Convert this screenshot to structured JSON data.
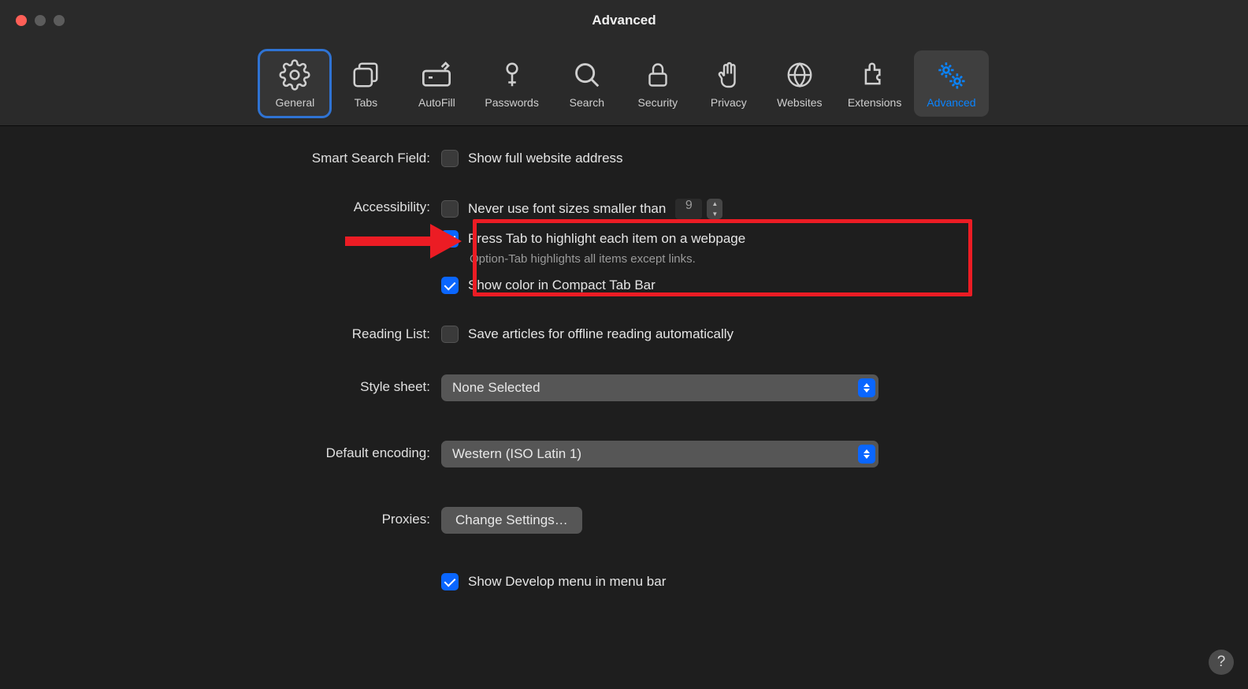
{
  "window": {
    "title": "Advanced"
  },
  "toolbar": {
    "items": [
      {
        "label": "General"
      },
      {
        "label": "Tabs"
      },
      {
        "label": "AutoFill"
      },
      {
        "label": "Passwords"
      },
      {
        "label": "Search"
      },
      {
        "label": "Security"
      },
      {
        "label": "Privacy"
      },
      {
        "label": "Websites"
      },
      {
        "label": "Extensions"
      },
      {
        "label": "Advanced"
      }
    ]
  },
  "sections": {
    "smart_search": {
      "label": "Smart Search Field:",
      "show_full_address": "Show full website address"
    },
    "accessibility": {
      "label": "Accessibility:",
      "never_use_smaller": "Never use font sizes smaller than",
      "font_size_value": "9",
      "press_tab": "Press Tab to highlight each item on a webpage",
      "press_tab_hint": "Option-Tab highlights all items except links.",
      "show_color": "Show color in Compact Tab Bar"
    },
    "reading_list": {
      "label": "Reading List:",
      "save_offline": "Save articles for offline reading automatically"
    },
    "style_sheet": {
      "label": "Style sheet:",
      "value": "None Selected"
    },
    "encoding": {
      "label": "Default encoding:",
      "value": "Western (ISO Latin 1)"
    },
    "proxies": {
      "label": "Proxies:",
      "button": "Change Settings…"
    },
    "develop": {
      "show_develop": "Show Develop menu in menu bar"
    }
  },
  "help": {
    "label": "?"
  }
}
